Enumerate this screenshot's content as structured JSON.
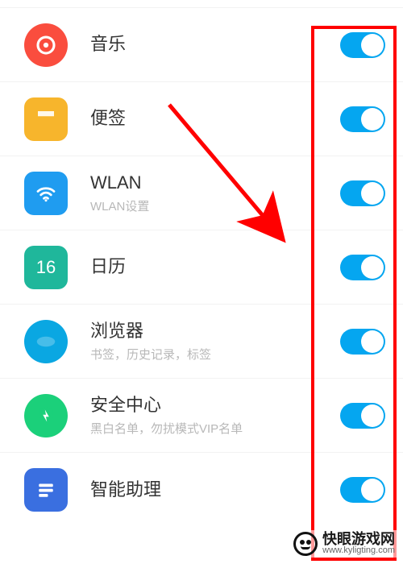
{
  "colors": {
    "toggle_on": "#05a6f0",
    "music": "#fa4d3e",
    "notes": "#f7b52c",
    "wlan": "#1f9cf0",
    "calendar": "#1fb79b",
    "browser": "#0aa7e2",
    "security": "#1bd07a",
    "assistant": "#3a6fe0"
  },
  "items": [
    {
      "id": "music",
      "title": "音乐",
      "sub": "",
      "toggle": true,
      "shape": "circle"
    },
    {
      "id": "notes",
      "title": "便签",
      "sub": "",
      "toggle": true,
      "shape": "square"
    },
    {
      "id": "wlan",
      "title": "WLAN",
      "sub": "WLAN设置",
      "toggle": true,
      "shape": "square"
    },
    {
      "id": "calendar",
      "title": "日历",
      "sub": "",
      "toggle": true,
      "shape": "square"
    },
    {
      "id": "browser",
      "title": "浏览器",
      "sub": "书签，历史记录，标签",
      "toggle": true,
      "shape": "circle"
    },
    {
      "id": "security",
      "title": "安全中心",
      "sub": "黑白名单，勿扰模式VIP名单",
      "toggle": true,
      "shape": "circle"
    },
    {
      "id": "assistant",
      "title": "智能助理",
      "sub": "",
      "toggle": true,
      "shape": "square"
    }
  ],
  "calendar_day": "16",
  "watermark": {
    "name": "快眼游戏网",
    "url": "www.kyligting.com"
  }
}
